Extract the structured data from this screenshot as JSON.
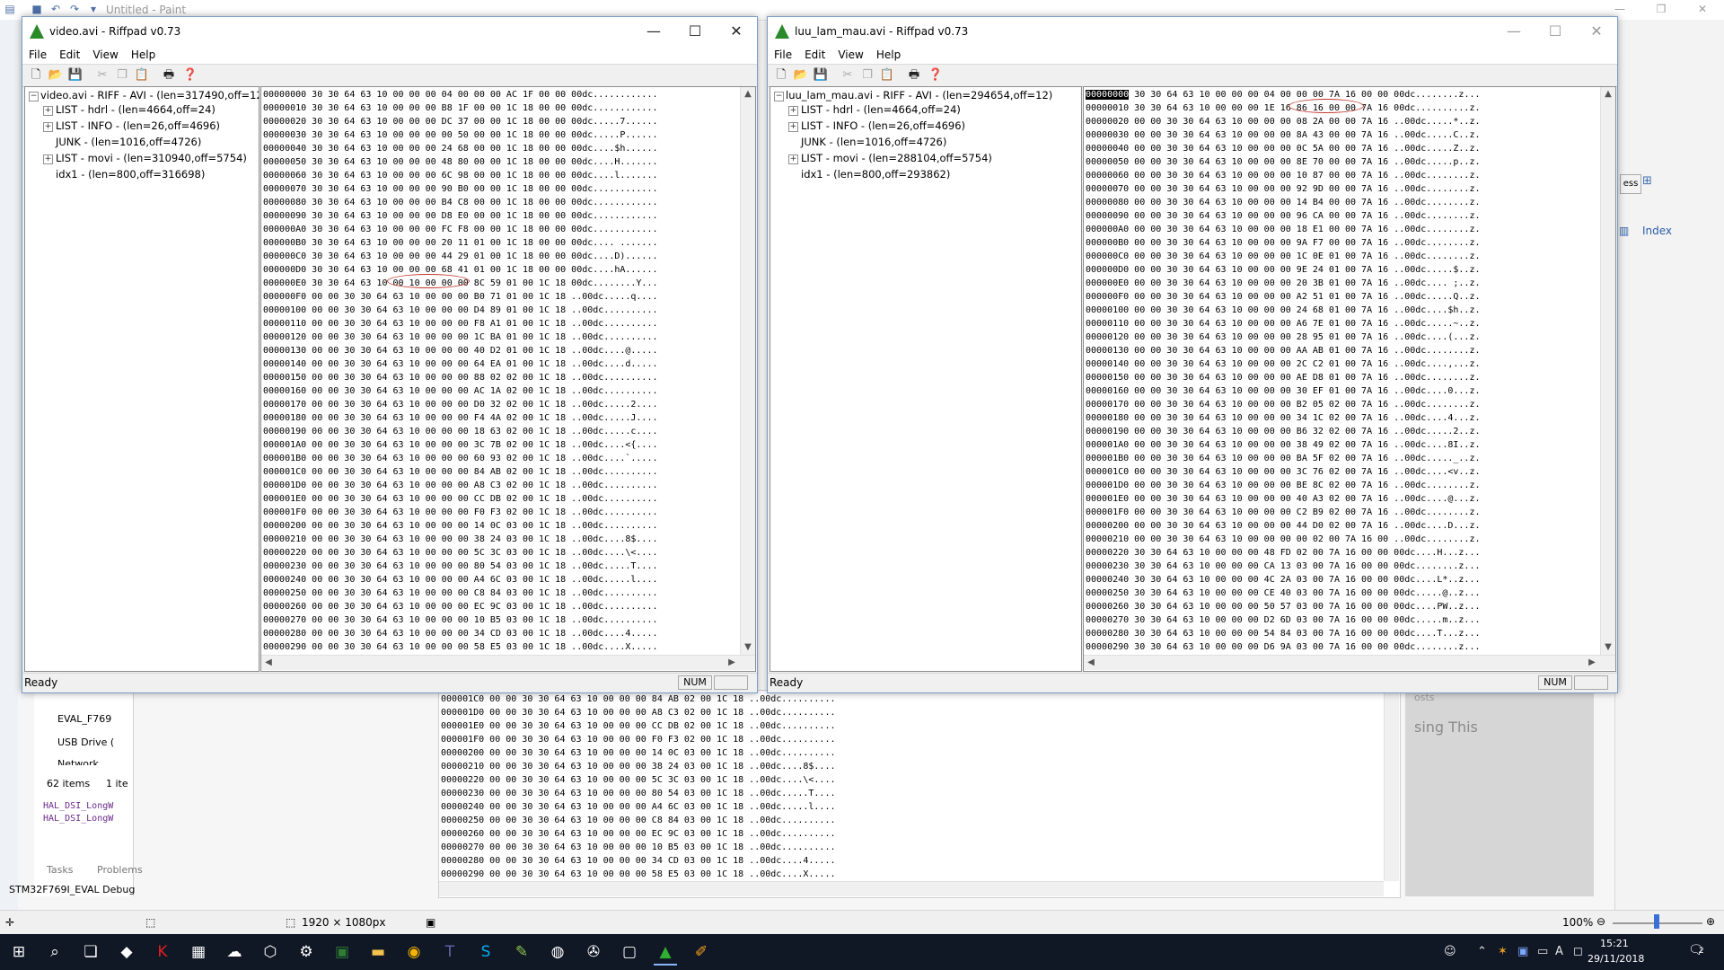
{
  "paint": {
    "title": "Untitled - Paint",
    "status_dimensions": "1920 × 1080px",
    "zoom": "100%"
  },
  "background": {
    "ide_items": [
      "EVAL_F769",
      "USB Drive (",
      "Network"
    ],
    "items_count": "62 items",
    "items_selected": "1 ite",
    "code_lines": [
      "HAL_DSI_LongW",
      "HAL_DSI_LongW"
    ],
    "tabs": [
      "Tasks",
      "Problems"
    ],
    "debug_label": "STM32F769I_EVAL Debug",
    "right_panel_index": "Index",
    "right_panel_text": "sing This",
    "right_panel_text2": "osts",
    "right_panel_btn": "ess"
  },
  "bg_dump": [
    "000001C0 00 00 30 30 64 63 10 00 00 00 84 AB 02 00 1C 18 ..00dc..........",
    "000001D0 00 00 30 30 64 63 10 00 00 00 A8 C3 02 00 1C 18 ..00dc..........",
    "000001E0 00 00 30 30 64 63 10 00 00 00 CC DB 02 00 1C 18 ..00dc..........",
    "000001F0 00 00 30 30 64 63 10 00 00 00 F0 F3 02 00 1C 18 ..00dc..........",
    "00000200 00 00 30 30 64 63 10 00 00 00 14 0C 03 00 1C 18 ..00dc..........",
    "00000210 00 00 30 30 64 63 10 00 00 00 38 24 03 00 1C 18 ..00dc....8$....",
    "00000220 00 00 30 30 64 63 10 00 00 00 5C 3C 03 00 1C 18 ..00dc....\\<....",
    "00000230 00 00 30 30 64 63 10 00 00 00 80 54 03 00 1C 18 ..00dc.....T....",
    "00000240 00 00 30 30 64 63 10 00 00 00 A4 6C 03 00 1C 18 ..00dc.....l....",
    "00000250 00 00 30 30 64 63 10 00 00 00 C8 84 03 00 1C 18 ..00dc..........",
    "00000260 00 00 30 30 64 63 10 00 00 00 EC 9C 03 00 1C 18 ..00dc..........",
    "00000270 00 00 30 30 64 63 10 00 00 00 10 B5 03 00 1C 18 ..00dc..........",
    "00000280 00 00 30 30 64 63 10 00 00 00 34 CD 03 00 1C 18 ..00dc....4.....",
    "00000290 00 00 30 30 64 63 10 00 00 00 58 E5 03 00 1C 18 ..00dc....X....."
  ],
  "left_win": {
    "title": "video.avi - Riffpad v0.73",
    "menu": [
      "File",
      "Edit",
      "View",
      "Help"
    ],
    "tree": [
      "video.avi - RIFF - AVI - (len=317490,off=12)",
      "LIST - hdrl - (len=4664,off=24)",
      "LIST - INFO - (len=26,off=4696)",
      "JUNK - (len=1016,off=4726)",
      "LIST - movi - (len=310940,off=5754)",
      "idx1 - (len=800,off=316698)"
    ],
    "status": "Ready",
    "num": "NUM",
    "hex": [
      "00000000 30 30 64 63 10 00 00 00 04 00 00 00 AC 1F 00 00 00dc............",
      "00000010 30 30 64 63 10 00 00 00 B8 1F 00 00 1C 18 00 00 00dc............",
      "00000020 30 30 64 63 10 00 00 00 DC 37 00 00 1C 18 00 00 00dc.....7......",
      "00000030 30 30 64 63 10 00 00 00 00 50 00 00 1C 18 00 00 00dc.....P......",
      "00000040 30 30 64 63 10 00 00 00 24 68 00 00 1C 18 00 00 00dc....$h......",
      "00000050 30 30 64 63 10 00 00 00 48 80 00 00 1C 18 00 00 00dc....H.......",
      "00000060 30 30 64 63 10 00 00 00 6C 98 00 00 1C 18 00 00 00dc....l.......",
      "00000070 30 30 64 63 10 00 00 00 90 B0 00 00 1C 18 00 00 00dc............",
      "00000080 30 30 64 63 10 00 00 00 B4 C8 00 00 1C 18 00 00 00dc............",
      "00000090 30 30 64 63 10 00 00 00 D8 E0 00 00 1C 18 00 00 00dc............",
      "000000A0 30 30 64 63 10 00 00 00 FC F8 00 00 1C 18 00 00 00dc............",
      "000000B0 30 30 64 63 10 00 00 00 20 11 01 00 1C 18 00 00 00dc.... .......",
      "000000C0 30 30 64 63 10 00 00 00 44 29 01 00 1C 18 00 00 00dc....D)......",
      "000000D0 30 30 64 63 10 00 00 00 68 41 01 00 1C 18 00 00 00dc....hA......",
      "000000E0 30 30 64 63 10 00 10 00 00 00 8C 59 01 00 1C 18 00dc........Y...",
      "000000F0 00 00 30 30 64 63 10 00 00 00 B0 71 01 00 1C 18 ..00dc.....q....",
      "00000100 00 00 30 30 64 63 10 00 00 00 D4 89 01 00 1C 18 ..00dc..........",
      "00000110 00 00 30 30 64 63 10 00 00 00 F8 A1 01 00 1C 18 ..00dc..........",
      "00000120 00 00 30 30 64 63 10 00 00 00 1C BA 01 00 1C 18 ..00dc..........",
      "00000130 00 00 30 30 64 63 10 00 00 00 40 D2 01 00 1C 18 ..00dc....@.....",
      "00000140 00 00 30 30 64 63 10 00 00 00 64 EA 01 00 1C 18 ..00dc....d.....",
      "00000150 00 00 30 30 64 63 10 00 00 00 88 02 02 00 1C 18 ..00dc..........",
      "00000160 00 00 30 30 64 63 10 00 00 00 AC 1A 02 00 1C 18 ..00dc..........",
      "00000170 00 00 30 30 64 63 10 00 00 00 D0 32 02 00 1C 18 ..00dc.....2....",
      "00000180 00 00 30 30 64 63 10 00 00 00 F4 4A 02 00 1C 18 ..00dc.....J....",
      "00000190 00 00 30 30 64 63 10 00 00 00 18 63 02 00 1C 18 ..00dc.....c....",
      "000001A0 00 00 30 30 64 63 10 00 00 00 3C 7B 02 00 1C 18 ..00dc....<{....",
      "000001B0 00 00 30 30 64 63 10 00 00 00 60 93 02 00 1C 18 ..00dc....`.....",
      "000001C0 00 00 30 30 64 63 10 00 00 00 84 AB 02 00 1C 18 ..00dc..........",
      "000001D0 00 00 30 30 64 63 10 00 00 00 A8 C3 02 00 1C 18 ..00dc..........",
      "000001E0 00 00 30 30 64 63 10 00 00 00 CC DB 02 00 1C 18 ..00dc..........",
      "000001F0 00 00 30 30 64 63 10 00 00 00 F0 F3 02 00 1C 18 ..00dc..........",
      "00000200 00 00 30 30 64 63 10 00 00 00 14 0C 03 00 1C 18 ..00dc..........",
      "00000210 00 00 30 30 64 63 10 00 00 00 38 24 03 00 1C 18 ..00dc....8$....",
      "00000220 00 00 30 30 64 63 10 00 00 00 5C 3C 03 00 1C 18 ..00dc....\\<....",
      "00000230 00 00 30 30 64 63 10 00 00 00 80 54 03 00 1C 18 ..00dc.....T....",
      "00000240 00 00 30 30 64 63 10 00 00 00 A4 6C 03 00 1C 18 ..00dc.....l....",
      "00000250 00 00 30 30 64 63 10 00 00 00 C8 84 03 00 1C 18 ..00dc..........",
      "00000260 00 00 30 30 64 63 10 00 00 00 EC 9C 03 00 1C 18 ..00dc..........",
      "00000270 00 00 30 30 64 63 10 00 00 00 10 B5 03 00 1C 18 ..00dc..........",
      "00000280 00 00 30 30 64 63 10 00 00 00 34 CD 03 00 1C 18 ..00dc....4.....",
      "00000290 00 00 30 30 64 63 10 00 00 00 58 E5 03 00 1C 18 ..00dc....X....."
    ]
  },
  "right_win": {
    "title": "luu_lam_mau.avi - Riffpad v0.73",
    "menu": [
      "File",
      "Edit",
      "View",
      "Help"
    ],
    "tree": [
      "luu_lam_mau.avi - RIFF - AVI - (len=294654,off=12)",
      "LIST - hdrl - (len=4664,off=24)",
      "LIST - INFO - (len=26,off=4696)",
      "JUNK - (len=1016,off=4726)",
      "LIST - movi - (len=288104,off=5754)",
      "idx1 - (len=800,off=293862)"
    ],
    "status": "Ready",
    "num": "NUM",
    "first_addr": "00000000",
    "hex": [
      " 30 30 64 63 10 00 00 00 04 00 00 00 7A 16 00 00 00dc........z...",
      "00000010 30 30 64 63 10 00 00 00 1E 16 86 16 00 00 7A 16 00dc..........z.",
      "00000020 00 00 30 30 64 63 10 00 00 00 08 2A 00 00 7A 16 ..00dc.....*..z.",
      "00000030 00 00 30 30 64 63 10 00 00 00 8A 43 00 00 7A 16 ..00dc.....C..z.",
      "00000040 00 00 30 30 64 63 10 00 00 00 0C 5A 00 00 7A 16 ..00dc.....Z..z.",
      "00000050 00 00 30 30 64 63 10 00 00 00 8E 70 00 00 7A 16 ..00dc.....p..z.",
      "00000060 00 00 30 30 64 63 10 00 00 00 10 87 00 00 7A 16 ..00dc........z.",
      "00000070 00 00 30 30 64 63 10 00 00 00 92 9D 00 00 7A 16 ..00dc........z.",
      "00000080 00 00 30 30 64 63 10 00 00 00 14 B4 00 00 7A 16 ..00dc........z.",
      "00000090 00 00 30 30 64 63 10 00 00 00 96 CA 00 00 7A 16 ..00dc........z.",
      "000000A0 00 00 30 30 64 63 10 00 00 00 18 E1 00 00 7A 16 ..00dc........z.",
      "000000B0 00 00 30 30 64 63 10 00 00 00 9A F7 00 00 7A 16 ..00dc........z.",
      "000000C0 00 00 30 30 64 63 10 00 00 00 1C 0E 01 00 7A 16 ..00dc........z.",
      "000000D0 00 00 30 30 64 63 10 00 00 00 9E 24 01 00 7A 16 ..00dc.....$..z.",
      "000000E0 00 00 30 30 64 63 10 00 00 00 20 3B 01 00 7A 16 ..00dc.... ;..z.",
      "000000F0 00 00 30 30 64 63 10 00 00 00 A2 51 01 00 7A 16 ..00dc.....Q..z.",
      "00000100 00 00 30 30 64 63 10 00 00 00 24 68 01 00 7A 16 ..00dc....$h..z.",
      "00000110 00 00 30 30 64 63 10 00 00 00 A6 7E 01 00 7A 16 ..00dc.....~..z.",
      "00000120 00 00 30 30 64 63 10 00 00 00 28 95 01 00 7A 16 ..00dc....(...z.",
      "00000130 00 00 30 30 64 63 10 00 00 00 AA AB 01 00 7A 16 ..00dc........z.",
      "00000140 00 00 30 30 64 63 10 00 00 00 2C C2 01 00 7A 16 ..00dc....,...z.",
      "00000150 00 00 30 30 64 63 10 00 00 00 AE D8 01 00 7A 16 ..00dc........z.",
      "00000160 00 00 30 30 64 63 10 00 00 00 30 EF 01 00 7A 16 ..00dc....0...z.",
      "00000170 00 00 30 30 64 63 10 00 00 00 B2 05 02 00 7A 16 ..00dc........z.",
      "00000180 00 00 30 30 64 63 10 00 00 00 34 1C 02 00 7A 16 ..00dc....4...z.",
      "00000190 00 00 30 30 64 63 10 00 00 00 B6 32 02 00 7A 16 ..00dc.....2..z.",
      "000001A0 00 00 30 30 64 63 10 00 00 00 38 49 02 00 7A 16 ..00dc....8I..z.",
      "000001B0 00 00 30 30 64 63 10 00 00 00 BA 5F 02 00 7A 16 ..00dc....._..z.",
      "000001C0 00 00 30 30 64 63 10 00 00 00 3C 76 02 00 7A 16 ..00dc....<v..z.",
      "000001D0 00 00 30 30 64 63 10 00 00 00 BE 8C 02 00 7A 16 ..00dc........z.",
      "000001E0 00 00 30 30 64 63 10 00 00 00 40 A3 02 00 7A 16 ..00dc....@...z.",
      "000001F0 00 00 30 30 64 63 10 00 00 00 C2 B9 02 00 7A 16 ..00dc........z.",
      "00000200 00 00 30 30 64 63 10 00 00 00 44 D0 02 00 7A 16 ..00dc....D...z.",
      "00000210 00 00 30 30 64 63 10 00 00 00 00 02 00 7A 16 00 ..00dc........z.",
      "00000220 30 30 64 63 10 00 00 00 48 FD 02 00 7A 16 00 00 00dc....H...z...",
      "00000230 30 30 64 63 10 00 00 00 CA 13 03 00 7A 16 00 00 00dc........z...",
      "00000240 30 30 64 63 10 00 00 00 4C 2A 03 00 7A 16 00 00 00dc....L*..z...",
      "00000250 30 30 64 63 10 00 00 00 CE 40 03 00 7A 16 00 00 00dc.....@..z...",
      "00000260 30 30 64 63 10 00 00 00 50 57 03 00 7A 16 00 00 00dc....PW..z...",
      "00000270 30 30 64 63 10 00 00 00 D2 6D 03 00 7A 16 00 00 00dc.....m..z...",
      "00000280 30 30 64 63 10 00 00 00 54 84 03 00 7A 16 00 00 00dc....T...z...",
      "00000290 30 30 64 63 10 00 00 00 D6 9A 03 00 7A 16 00 00 00dc........z..."
    ]
  },
  "taskbar": {
    "time": "15:21",
    "date": "29/11/2018",
    "notification_count": "2",
    "icons": [
      "start-icon",
      "search-icon",
      "task-view-icon",
      "app-icon",
      "antivirus-icon",
      "office-icon",
      "chat-icon",
      "box-icon",
      "settings-icon",
      "calc-icon",
      "file-explorer-icon",
      "chrome-icon",
      "teams-icon",
      "skype-icon",
      "notepad-icon",
      "disc-icon",
      "clapper-icon",
      "window-icon",
      "riffpad-icon",
      "paint-icon"
    ]
  }
}
